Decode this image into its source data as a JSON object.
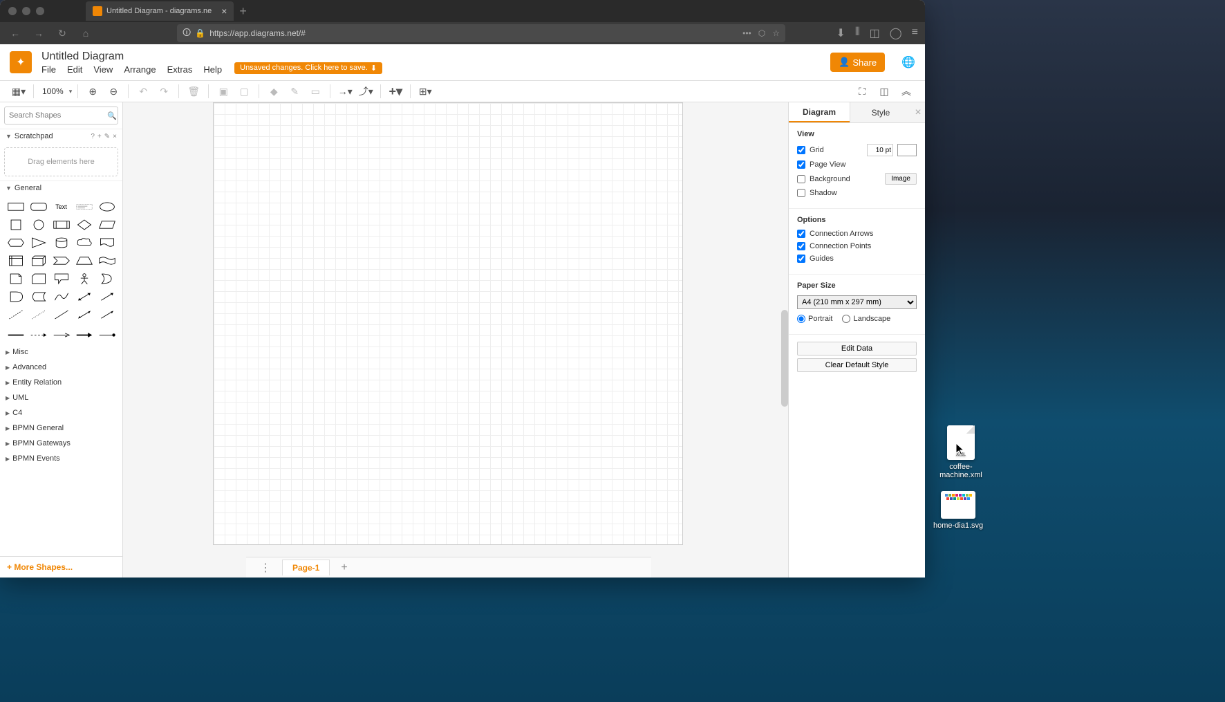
{
  "browser": {
    "tab_title": "Untitled Diagram - diagrams.ne",
    "url": "https://app.diagrams.net/#"
  },
  "app": {
    "title": "Untitled Diagram",
    "menus": [
      "File",
      "Edit",
      "View",
      "Arrange",
      "Extras",
      "Help"
    ],
    "unsaved_msg": "Unsaved changes. Click here to save.",
    "share_label": "Share"
  },
  "toolbar": {
    "zoom": "100%"
  },
  "left": {
    "search_placeholder": "Search Shapes",
    "scratchpad_label": "Scratchpad",
    "scratchpad_hint": "Drag elements here",
    "general_label": "General",
    "categories": [
      "Misc",
      "Advanced",
      "Entity Relation",
      "UML",
      "C4",
      "BPMN General",
      "BPMN Gateways",
      "BPMN Events"
    ],
    "more_shapes": "More Shapes..."
  },
  "tabs": {
    "page1": "Page-1"
  },
  "right": {
    "tab_diagram": "Diagram",
    "tab_style": "Style",
    "view_h": "View",
    "grid_label": "Grid",
    "grid_val": "10 pt",
    "pageview_label": "Page View",
    "background_label": "Background",
    "image_btn": "Image",
    "shadow_label": "Shadow",
    "options_h": "Options",
    "conn_arrows": "Connection Arrows",
    "conn_points": "Connection Points",
    "guides": "Guides",
    "paper_h": "Paper Size",
    "paper_val": "A4 (210 mm x 297 mm)",
    "portrait": "Portrait",
    "landscape": "Landscape",
    "edit_data": "Edit Data",
    "clear_style": "Clear Default Style"
  },
  "desktop": {
    "file1": "coffee-machine.xml",
    "file1_badge": "XML",
    "file2": "home-dia1.svg"
  }
}
